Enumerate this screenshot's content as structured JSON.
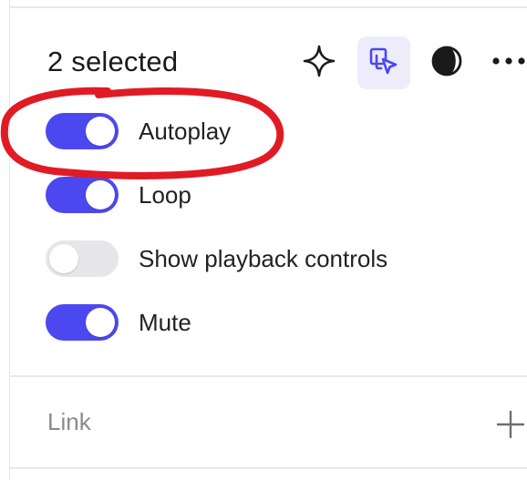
{
  "header": {
    "title": "2 selected",
    "icons": [
      "sparkle-icon",
      "select-frames-icon",
      "contrast-icon",
      "more-icon"
    ],
    "active_icon": "select-frames-icon"
  },
  "settings": [
    {
      "label": "Autoplay",
      "on": true
    },
    {
      "label": "Loop",
      "on": true
    },
    {
      "label": "Show playback controls",
      "on": false
    },
    {
      "label": "Mute",
      "on": true
    }
  ],
  "link": {
    "label": "Link",
    "add_icon": "plus-icon"
  },
  "annotation": {
    "shape": "hand-drawn-ellipse",
    "color": "#e01b24",
    "target": "Autoplay"
  },
  "colors": {
    "accent": "#4c48f0",
    "toggle_off": "#e6e6e8",
    "active_bg": "#ececfb"
  }
}
